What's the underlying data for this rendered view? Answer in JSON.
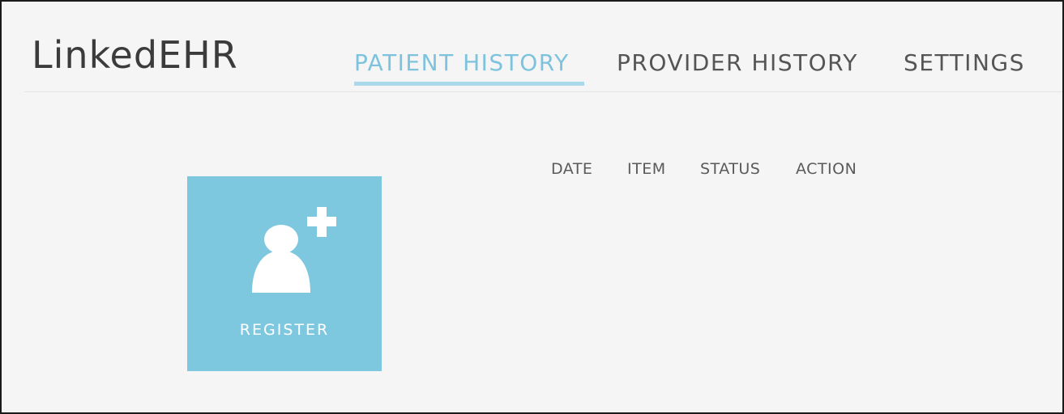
{
  "app": {
    "title": "LinkedEHR"
  },
  "nav": {
    "items": [
      {
        "label": "PATIENT HISTORY",
        "active": true
      },
      {
        "label": "PROVIDER HISTORY",
        "active": false
      },
      {
        "label": "SETTINGS",
        "active": false
      }
    ]
  },
  "register": {
    "label": "REGISTER",
    "icon": "add-user-icon"
  },
  "table": {
    "columns": [
      "DATE",
      "ITEM",
      "STATUS",
      "ACTION"
    ]
  },
  "colors": {
    "accent": "#7ec3dd",
    "tile": "#7ec8df",
    "background": "#f5f5f5"
  }
}
